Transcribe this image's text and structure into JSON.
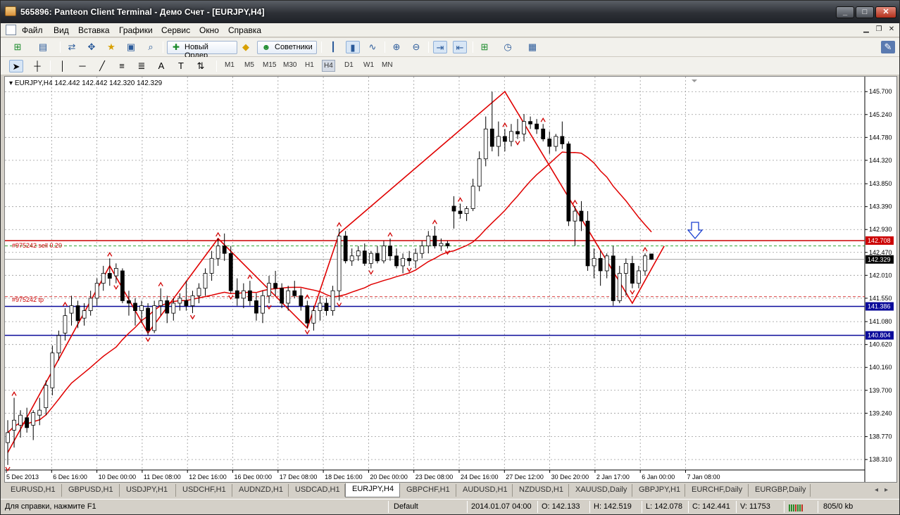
{
  "window": {
    "title": "565896: Panteon Client Terminal - Демо Счет - [EURJPY,H4]",
    "min": "_",
    "max": "□",
    "close": "✕"
  },
  "menu": [
    "Файл",
    "Вид",
    "Вставка",
    "Графики",
    "Сервис",
    "Окно",
    "Справка"
  ],
  "toolbar": {
    "new_order": "Новый Ордер",
    "advisors": "Советники"
  },
  "timeframes": [
    "M1",
    "M5",
    "M15",
    "M30",
    "H1",
    "H4",
    "D1",
    "W1",
    "MN"
  ],
  "active_timeframe": "H4",
  "chart": {
    "header": "EURJPY,H4  142.442 142.442 142.320 142.329",
    "sell_label": "#975242 sell 0.20",
    "tp_label": "#975242 tp",
    "level_red": "142.708",
    "level_current": "142.329",
    "level_blue1": "141.386",
    "level_blue2": "140.804",
    "price_axis": [
      "145.700",
      "145.240",
      "144.780",
      "144.320",
      "143.850",
      "143.390",
      "142.930",
      "142.470",
      "142.010",
      "141.550",
      "141.080",
      "140.620",
      "140.160",
      "139.700",
      "139.240",
      "138.770",
      "138.310"
    ],
    "time_axis": [
      "5 Dec 2013",
      "6 Dec 16:00",
      "10 Dec 00:00",
      "11 Dec 08:00",
      "12 Dec 16:00",
      "16 Dec 00:00",
      "17 Dec 08:00",
      "18 Dec 16:00",
      "20 Dec 00:00",
      "23 Dec 08:00",
      "24 Dec 16:00",
      "27 Dec 12:00",
      "30 Dec 20:00",
      "2 Jan 17:00",
      "6 Jan 00:00",
      "7 Jan 08:00"
    ],
    "colors": {
      "candle": "#000000",
      "ma": "#e00000",
      "zigzag": "#e00000",
      "level_red": "#cc0000",
      "level_blue": "#0a0a9a",
      "arrow": "#1a3fd0",
      "grid": "#9a9a9a"
    }
  },
  "chart_data": {
    "type": "candlestick",
    "symbol": "EURJPY",
    "timeframe": "H4",
    "ylim": [
      138.1,
      146.0
    ],
    "candles": [
      {
        "o": 138.65,
        "h": 139.1,
        "l": 138.2,
        "c": 138.85
      },
      {
        "o": 138.9,
        "h": 139.55,
        "l": 138.55,
        "c": 139.1
      },
      {
        "o": 139.0,
        "h": 139.3,
        "l": 138.75,
        "c": 139.2
      },
      {
        "o": 139.15,
        "h": 139.35,
        "l": 138.85,
        "c": 138.95
      },
      {
        "o": 139.0,
        "h": 139.3,
        "l": 138.7,
        "c": 139.25
      },
      {
        "o": 139.2,
        "h": 139.55,
        "l": 139.0,
        "c": 139.3
      },
      {
        "o": 139.35,
        "h": 139.9,
        "l": 139.2,
        "c": 139.8
      },
      {
        "o": 139.75,
        "h": 140.6,
        "l": 139.6,
        "c": 140.45
      },
      {
        "o": 140.45,
        "h": 140.9,
        "l": 140.3,
        "c": 140.8
      },
      {
        "o": 140.85,
        "h": 141.35,
        "l": 140.7,
        "c": 141.2
      },
      {
        "o": 141.25,
        "h": 141.6,
        "l": 141.0,
        "c": 141.4
      },
      {
        "o": 141.4,
        "h": 141.5,
        "l": 140.95,
        "c": 141.1
      },
      {
        "o": 141.15,
        "h": 141.45,
        "l": 141.0,
        "c": 141.3
      },
      {
        "o": 141.3,
        "h": 141.7,
        "l": 141.2,
        "c": 141.55
      },
      {
        "o": 141.55,
        "h": 141.95,
        "l": 141.4,
        "c": 141.85
      },
      {
        "o": 141.85,
        "h": 142.2,
        "l": 141.7,
        "c": 142.05
      },
      {
        "o": 142.05,
        "h": 142.35,
        "l": 141.8,
        "c": 141.95
      },
      {
        "o": 142.0,
        "h": 142.25,
        "l": 141.85,
        "c": 142.15
      },
      {
        "o": 142.1,
        "h": 142.15,
        "l": 141.45,
        "c": 141.5
      },
      {
        "o": 141.5,
        "h": 141.7,
        "l": 141.2,
        "c": 141.45
      },
      {
        "o": 141.45,
        "h": 141.55,
        "l": 141.0,
        "c": 141.3
      },
      {
        "o": 141.3,
        "h": 141.5,
        "l": 141.05,
        "c": 141.4
      },
      {
        "o": 141.35,
        "h": 141.45,
        "l": 140.8,
        "c": 140.9
      },
      {
        "o": 140.9,
        "h": 141.5,
        "l": 140.85,
        "c": 141.4
      },
      {
        "o": 141.4,
        "h": 141.75,
        "l": 141.2,
        "c": 141.5
      },
      {
        "o": 141.5,
        "h": 141.6,
        "l": 141.05,
        "c": 141.25
      },
      {
        "o": 141.25,
        "h": 141.55,
        "l": 141.1,
        "c": 141.45
      },
      {
        "o": 141.45,
        "h": 141.65,
        "l": 141.3,
        "c": 141.55
      },
      {
        "o": 141.5,
        "h": 141.9,
        "l": 141.3,
        "c": 141.4
      },
      {
        "o": 141.4,
        "h": 141.7,
        "l": 141.25,
        "c": 141.6
      },
      {
        "o": 141.6,
        "h": 141.85,
        "l": 141.45,
        "c": 141.75
      },
      {
        "o": 141.75,
        "h": 142.15,
        "l": 141.6,
        "c": 142.05
      },
      {
        "o": 142.05,
        "h": 142.5,
        "l": 141.9,
        "c": 142.35
      },
      {
        "o": 142.35,
        "h": 142.75,
        "l": 142.2,
        "c": 142.6
      },
      {
        "o": 142.6,
        "h": 142.85,
        "l": 142.3,
        "c": 142.45
      },
      {
        "o": 142.45,
        "h": 142.6,
        "l": 141.65,
        "c": 141.7
      },
      {
        "o": 141.7,
        "h": 141.95,
        "l": 141.4,
        "c": 141.55
      },
      {
        "o": 141.55,
        "h": 141.85,
        "l": 141.35,
        "c": 141.7
      },
      {
        "o": 141.7,
        "h": 141.9,
        "l": 141.4,
        "c": 141.5
      },
      {
        "o": 141.5,
        "h": 141.65,
        "l": 141.1,
        "c": 141.25
      },
      {
        "o": 141.25,
        "h": 141.7,
        "l": 141.05,
        "c": 141.6
      },
      {
        "o": 141.6,
        "h": 142.0,
        "l": 141.45,
        "c": 141.85
      },
      {
        "o": 141.85,
        "h": 142.1,
        "l": 141.6,
        "c": 141.75
      },
      {
        "o": 141.75,
        "h": 141.85,
        "l": 141.35,
        "c": 141.45
      },
      {
        "o": 141.45,
        "h": 141.8,
        "l": 141.3,
        "c": 141.7
      },
      {
        "o": 141.7,
        "h": 141.9,
        "l": 141.55,
        "c": 141.6
      },
      {
        "o": 141.6,
        "h": 141.75,
        "l": 141.3,
        "c": 141.4
      },
      {
        "o": 141.4,
        "h": 141.5,
        "l": 140.95,
        "c": 141.05
      },
      {
        "o": 141.05,
        "h": 141.4,
        "l": 140.9,
        "c": 141.3
      },
      {
        "o": 141.3,
        "h": 141.6,
        "l": 141.1,
        "c": 141.45
      },
      {
        "o": 141.45,
        "h": 141.55,
        "l": 141.2,
        "c": 141.3
      },
      {
        "o": 141.3,
        "h": 141.8,
        "l": 141.2,
        "c": 141.7
      },
      {
        "o": 141.7,
        "h": 142.95,
        "l": 141.5,
        "c": 142.8
      },
      {
        "o": 142.8,
        "h": 142.9,
        "l": 142.25,
        "c": 142.3
      },
      {
        "o": 142.3,
        "h": 142.55,
        "l": 142.2,
        "c": 142.4
      },
      {
        "o": 142.4,
        "h": 142.6,
        "l": 142.3,
        "c": 142.5
      },
      {
        "o": 142.5,
        "h": 142.65,
        "l": 142.2,
        "c": 142.25
      },
      {
        "o": 142.25,
        "h": 142.5,
        "l": 142.15,
        "c": 142.45
      },
      {
        "o": 142.45,
        "h": 142.6,
        "l": 142.25,
        "c": 142.3
      },
      {
        "o": 142.3,
        "h": 142.7,
        "l": 142.25,
        "c": 142.6
      },
      {
        "o": 142.6,
        "h": 142.75,
        "l": 142.3,
        "c": 142.4
      },
      {
        "o": 142.4,
        "h": 142.55,
        "l": 142.15,
        "c": 142.2
      },
      {
        "o": 142.2,
        "h": 142.45,
        "l": 142.05,
        "c": 142.35
      },
      {
        "o": 142.35,
        "h": 142.5,
        "l": 142.2,
        "c": 142.3
      },
      {
        "o": 142.3,
        "h": 142.55,
        "l": 142.15,
        "c": 142.45
      },
      {
        "o": 142.45,
        "h": 142.7,
        "l": 142.35,
        "c": 142.6
      },
      {
        "o": 142.6,
        "h": 142.9,
        "l": 142.45,
        "c": 142.8
      },
      {
        "o": 142.8,
        "h": 143.0,
        "l": 142.55,
        "c": 142.6
      },
      {
        "o": 142.6,
        "h": 142.75,
        "l": 142.5,
        "c": 142.65
      },
      {
        "o": 142.65,
        "h": 142.7,
        "l": 142.55,
        "c": 142.6
      },
      {
        "o": 143.4,
        "h": 143.6,
        "l": 142.95,
        "c": 143.3
      },
      {
        "o": 143.3,
        "h": 143.45,
        "l": 143.15,
        "c": 143.25
      },
      {
        "o": 143.25,
        "h": 143.4,
        "l": 143.1,
        "c": 143.35
      },
      {
        "o": 143.35,
        "h": 143.95,
        "l": 143.3,
        "c": 143.8
      },
      {
        "o": 143.8,
        "h": 144.5,
        "l": 143.7,
        "c": 144.35
      },
      {
        "o": 144.35,
        "h": 145.2,
        "l": 144.2,
        "c": 144.95
      },
      {
        "o": 144.95,
        "h": 145.7,
        "l": 144.5,
        "c": 144.6
      },
      {
        "o": 144.6,
        "h": 145.1,
        "l": 144.4,
        "c": 144.8
      },
      {
        "o": 144.8,
        "h": 144.95,
        "l": 144.5,
        "c": 144.7
      },
      {
        "o": 144.7,
        "h": 145.05,
        "l": 144.6,
        "c": 144.9
      },
      {
        "o": 144.9,
        "h": 145.15,
        "l": 144.75,
        "c": 144.85
      },
      {
        "o": 144.85,
        "h": 145.25,
        "l": 144.7,
        "c": 145.1
      },
      {
        "o": 145.1,
        "h": 145.2,
        "l": 144.95,
        "c": 145.05
      },
      {
        "o": 145.05,
        "h": 145.15,
        "l": 144.85,
        "c": 144.95
      },
      {
        "o": 144.95,
        "h": 145.05,
        "l": 144.7,
        "c": 144.75
      },
      {
        "o": 144.75,
        "h": 144.9,
        "l": 144.45,
        "c": 144.6
      },
      {
        "o": 144.6,
        "h": 144.85,
        "l": 144.5,
        "c": 144.8
      },
      {
        "o": 144.8,
        "h": 145.1,
        "l": 144.55,
        "c": 144.65
      },
      {
        "o": 144.65,
        "h": 144.7,
        "l": 143.0,
        "c": 143.1
      },
      {
        "o": 143.1,
        "h": 143.4,
        "l": 142.6,
        "c": 143.3
      },
      {
        "o": 143.3,
        "h": 143.5,
        "l": 142.9,
        "c": 143.1
      },
      {
        "o": 143.1,
        "h": 143.3,
        "l": 142.1,
        "c": 142.2
      },
      {
        "o": 142.2,
        "h": 142.55,
        "l": 141.95,
        "c": 142.35
      },
      {
        "o": 142.35,
        "h": 142.5,
        "l": 141.8,
        "c": 142.1
      },
      {
        "o": 142.1,
        "h": 142.45,
        "l": 141.95,
        "c": 142.4
      },
      {
        "o": 142.4,
        "h": 142.6,
        "l": 141.4,
        "c": 141.5
      },
      {
        "o": 141.5,
        "h": 142.2,
        "l": 141.45,
        "c": 142.05
      },
      {
        "o": 142.05,
        "h": 142.35,
        "l": 141.6,
        "c": 142.25
      },
      {
        "o": 142.25,
        "h": 142.4,
        "l": 141.75,
        "c": 141.85
      },
      {
        "o": 141.85,
        "h": 142.2,
        "l": 141.75,
        "c": 142.1
      },
      {
        "o": 142.1,
        "h": 142.45,
        "l": 142.0,
        "c": 142.4
      },
      {
        "o": 142.44,
        "h": 142.44,
        "l": 142.32,
        "c": 142.33
      }
    ]
  },
  "symbol_tabs": [
    "EURUSD,H1",
    "GBPUSD,H1",
    "USDJPY,H1",
    "USDCHF,H1",
    "AUDNZD,H1",
    "USDCAD,H1",
    "EURJPY,H4",
    "GBPCHF,H1",
    "AUDUSD,H1",
    "NZDUSD,H1",
    "XAUUSD,Daily",
    "GBPJPY,H1",
    "EURCHF,Daily",
    "EURGBP,Daily"
  ],
  "active_tab": "EURJPY,H4",
  "status": {
    "help": "Для справки, нажмите F1",
    "profile": "Default",
    "datetime": "2014.01.07 04:00",
    "open": "O: 142.133",
    "high": "H: 142.519",
    "low": "L: 142.078",
    "close": "C: 142.441",
    "volume": "V: 11753",
    "traffic": "805/0 kb"
  }
}
